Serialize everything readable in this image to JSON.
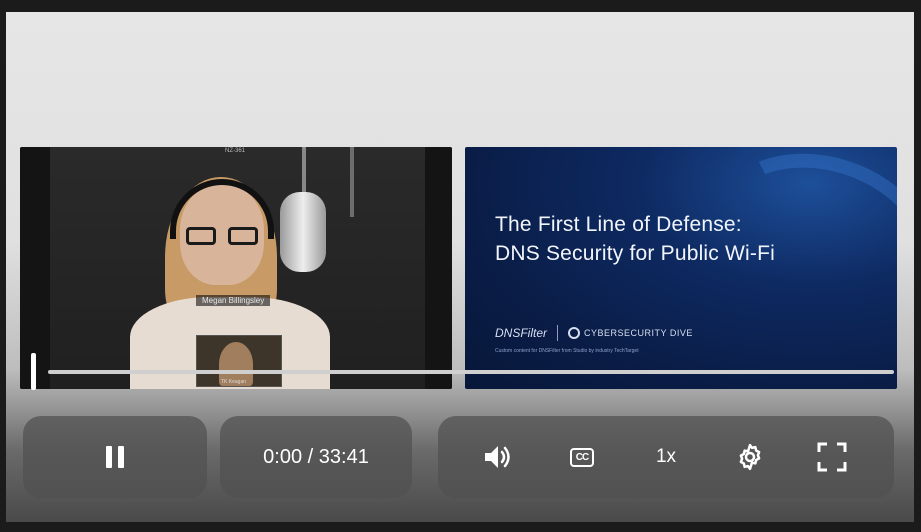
{
  "video": {
    "speaker_name": "Megan Billingsley",
    "top_tag": "NZ-361",
    "pip_label": "TK Keagan"
  },
  "slide": {
    "title_line1": "The First Line of Defense:",
    "title_line2": "DNS Security for Public Wi-Fi",
    "logo_dnsfilter": "DNSFilter",
    "logo_cyberdive": "CYBERSECURITY DIVE",
    "footnote": "Custom content for DNSFilter from Studio by industry TechTarget"
  },
  "player": {
    "progress": 0,
    "time_display": "0:00 / 33:41",
    "speed_label": "1x",
    "cc_label": "CC"
  },
  "icons": {
    "pause": "pause-icon",
    "volume": "volume-icon",
    "captions": "captions-icon",
    "settings": "gear-icon",
    "fullscreen": "fullscreen-icon"
  }
}
